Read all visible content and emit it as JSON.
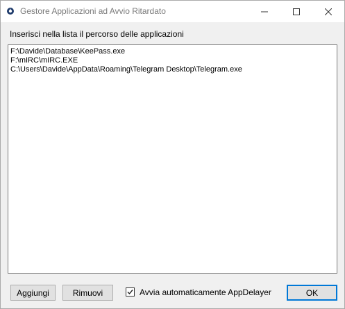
{
  "window": {
    "title": "Gestore Applicazioni ad Avvio Ritardato"
  },
  "instruction": "Inserisci nella lista il percorso delle applicazioni",
  "list": {
    "items": [
      "F:\\Davide\\Database\\KeePass.exe",
      "F:\\mIRC\\mIRC.EXE",
      "C:\\Users\\Davide\\AppData\\Roaming\\Telegram Desktop\\Telegram.exe"
    ]
  },
  "buttons": {
    "add": "Aggiungi",
    "remove": "Rimuovi",
    "ok": "OK"
  },
  "autostart": {
    "label": "Avvia automaticamente AppDelayer",
    "checked": true
  },
  "icons": {
    "app": "app-icon",
    "minimize": "minimize-icon",
    "maximize": "maximize-icon",
    "close": "close-icon",
    "check": "checkmark-icon"
  }
}
